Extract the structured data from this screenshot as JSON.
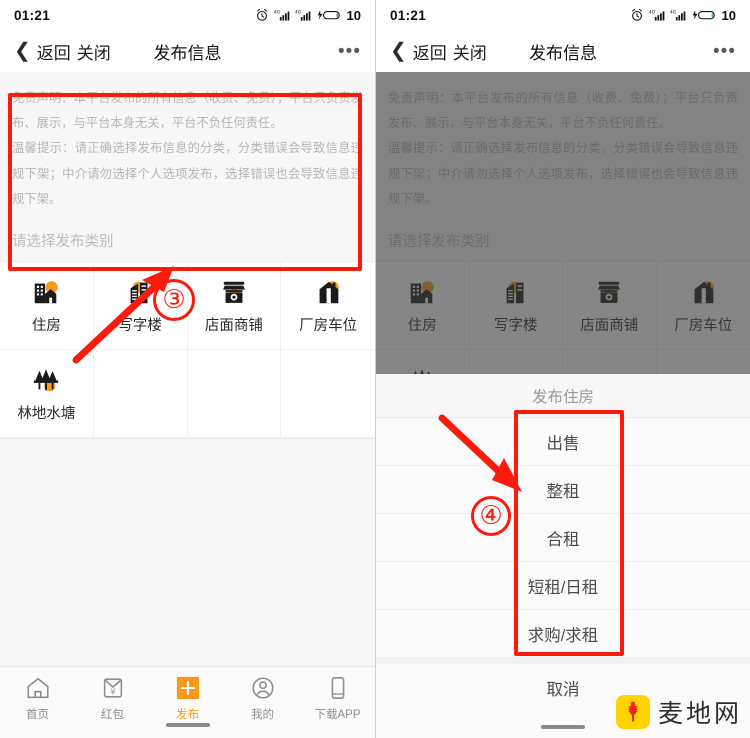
{
  "status_bar": {
    "time": "01:21",
    "battery_percent": "10",
    "icons": [
      "alarm-clock-icon",
      "signal-sim1-icon",
      "signal-sim2-icon",
      "charging-battery-icon"
    ]
  },
  "nav_bar": {
    "back_label": "返回",
    "close_label": "关闭",
    "title": "发布信息",
    "more_label": "•••"
  },
  "disclaimer": {
    "line1": "免责声明：本平台发布的所有信息（收费、免费）；平台只负责发布、展示，与平台本身无关，平台不负任何责任。",
    "line2": "温馨提示：请正确选择发布信息的分类，分类错误会导致信息违规下架；中介请勿选择个人选项发布，选择错误也会导致信息违规下架。"
  },
  "section": {
    "title": "请选择发布类别"
  },
  "categories": [
    {
      "label": "住房",
      "icon": "apartment-building-icon"
    },
    {
      "label": "写字楼",
      "icon": "office-tower-icon"
    },
    {
      "label": "店面商铺",
      "icon": "shopfront-icon"
    },
    {
      "label": "厂房车位",
      "icon": "factory-warehouse-icon"
    },
    {
      "label": "林地水塘",
      "icon": "forest-pond-icon"
    }
  ],
  "tabbar": [
    {
      "label": "首页",
      "icon": "home-icon",
      "active": false
    },
    {
      "label": "红包",
      "icon": "red-envelope-icon",
      "active": false
    },
    {
      "label": "发布",
      "icon": "plus-publish-icon",
      "active": true
    },
    {
      "label": "我的",
      "icon": "user-profile-icon",
      "active": false
    },
    {
      "label": "下载APP",
      "icon": "mobile-phone-icon",
      "active": false
    }
  ],
  "action_sheet": {
    "title": "发布住房",
    "options": [
      "出售",
      "整租",
      "合租",
      "短租/日租",
      "求购/求租"
    ],
    "cancel_label": "取消"
  },
  "annotations": {
    "left_marker": "③",
    "right_marker": "④",
    "color": "#fc1a0c"
  },
  "watermark": {
    "text": "麦地网",
    "badge_icon": "maidi-logo-icon",
    "badge_color": "#ffd400"
  }
}
